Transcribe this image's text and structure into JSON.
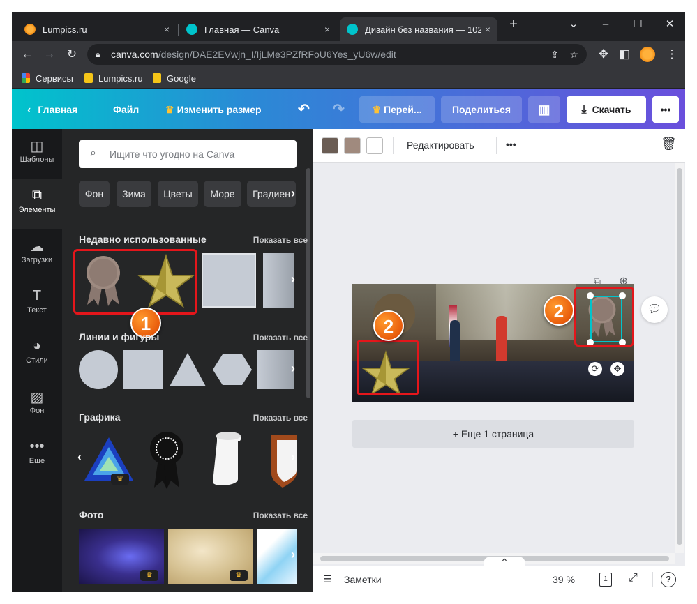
{
  "tabs": [
    {
      "title": "Lumpics.ru",
      "close": "×"
    },
    {
      "title": "Главная — Canva",
      "close": "×"
    },
    {
      "title": "Дизайн без названия — 1024",
      "close": "×"
    }
  ],
  "new_tab": "+",
  "window_controls": {
    "dropdown": "⌄",
    "minimize": "–",
    "maximize": "☐",
    "close": "✕"
  },
  "address": {
    "host": "canva.com",
    "path": "/design/DAE2EVwjn_I/IjLMe3PZfRFoU6Yes_yU6w/edit"
  },
  "bookmarks": [
    "Сервисы",
    "Lumpics.ru",
    "Google"
  ],
  "header": {
    "back": "Главная",
    "file": "Файл",
    "resize": "Изменить размер",
    "resize_crown": "♛",
    "upgrade": "Перей...",
    "share": "Поделиться",
    "download": "Скачать",
    "more": "•••"
  },
  "rail": [
    {
      "label": "Шаблоны",
      "icon": "template-icon"
    },
    {
      "label": "Элементы",
      "icon": "elements-icon"
    },
    {
      "label": "Загрузки",
      "icon": "upload-icon"
    },
    {
      "label": "Текст",
      "icon": "text-icon"
    },
    {
      "label": "Стили",
      "icon": "palette-icon"
    },
    {
      "label": "Фон",
      "icon": "background-icon"
    },
    {
      "label": "Еще",
      "icon": "more-icon"
    }
  ],
  "panel": {
    "search_placeholder": "Ищите что угодно на Canva",
    "chips": [
      "Фон",
      "Зима",
      "Цветы",
      "Море",
      "Градиен"
    ],
    "sections": [
      {
        "title": "Недавно использованные",
        "show_all": "Показать все"
      },
      {
        "title": "Линии и фигуры",
        "show_all": "Показать все"
      },
      {
        "title": "Графика",
        "show_all": "Показать все"
      },
      {
        "title": "Фото",
        "show_all": "Показать все"
      }
    ]
  },
  "context_toolbar": {
    "colors": [
      "#6b5d54",
      "#a08a7e",
      "#ffffff"
    ],
    "edit": "Редактировать",
    "more": "•••"
  },
  "workspace": {
    "add_page": "+ Еще 1 страница"
  },
  "footer": {
    "notes": "Заметки",
    "zoom": "39 %",
    "page_num": "1"
  },
  "annotations": [
    {
      "number": "1"
    },
    {
      "number": "2"
    },
    {
      "number": "2"
    }
  ],
  "colors": {
    "accent_red": "#e4161b",
    "badge_orange": "#e95d0c",
    "header_start": "#00c4cc",
    "header_end": "#6a4fdc"
  }
}
